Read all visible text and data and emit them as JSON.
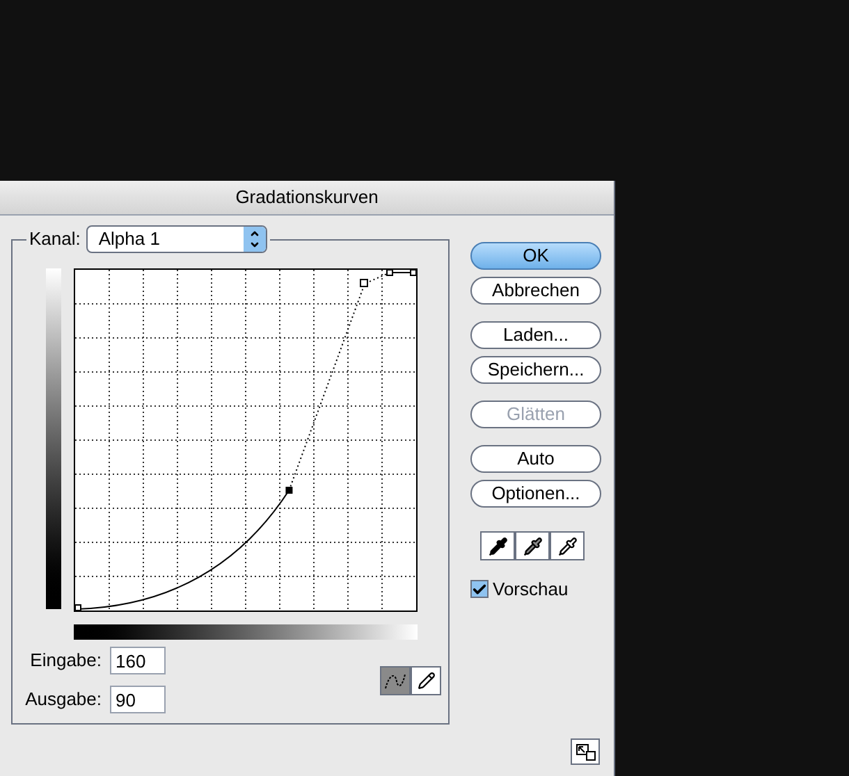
{
  "window": {
    "title": "Gradationskurven"
  },
  "channel": {
    "label": "Kanal:",
    "value": "Alpha 1"
  },
  "input": {
    "label": "Eingabe:",
    "value": "160"
  },
  "output": {
    "label": "Ausgabe:",
    "value": "90"
  },
  "tools": [
    {
      "kind": "curve",
      "selected": true
    },
    {
      "kind": "pencil",
      "selected": false
    }
  ],
  "button_groups": [
    [
      {
        "label": "OK",
        "default": true,
        "disabled": false
      },
      {
        "label": "Abbrechen",
        "default": false,
        "disabled": false
      }
    ],
    [
      {
        "label": "Laden...",
        "default": false,
        "disabled": false
      },
      {
        "label": "Speichern...",
        "default": false,
        "disabled": false
      }
    ],
    [
      {
        "label": "Glätten",
        "default": false,
        "disabled": true
      }
    ],
    [
      {
        "label": "Auto",
        "default": false,
        "disabled": false
      },
      {
        "label": "Optionen...",
        "default": false,
        "disabled": false
      }
    ]
  ],
  "eyedroppers": [
    {
      "kind": "black"
    },
    {
      "kind": "gray"
    },
    {
      "kind": "white"
    }
  ],
  "preview": {
    "label": "Vorschau",
    "checked": true
  }
}
